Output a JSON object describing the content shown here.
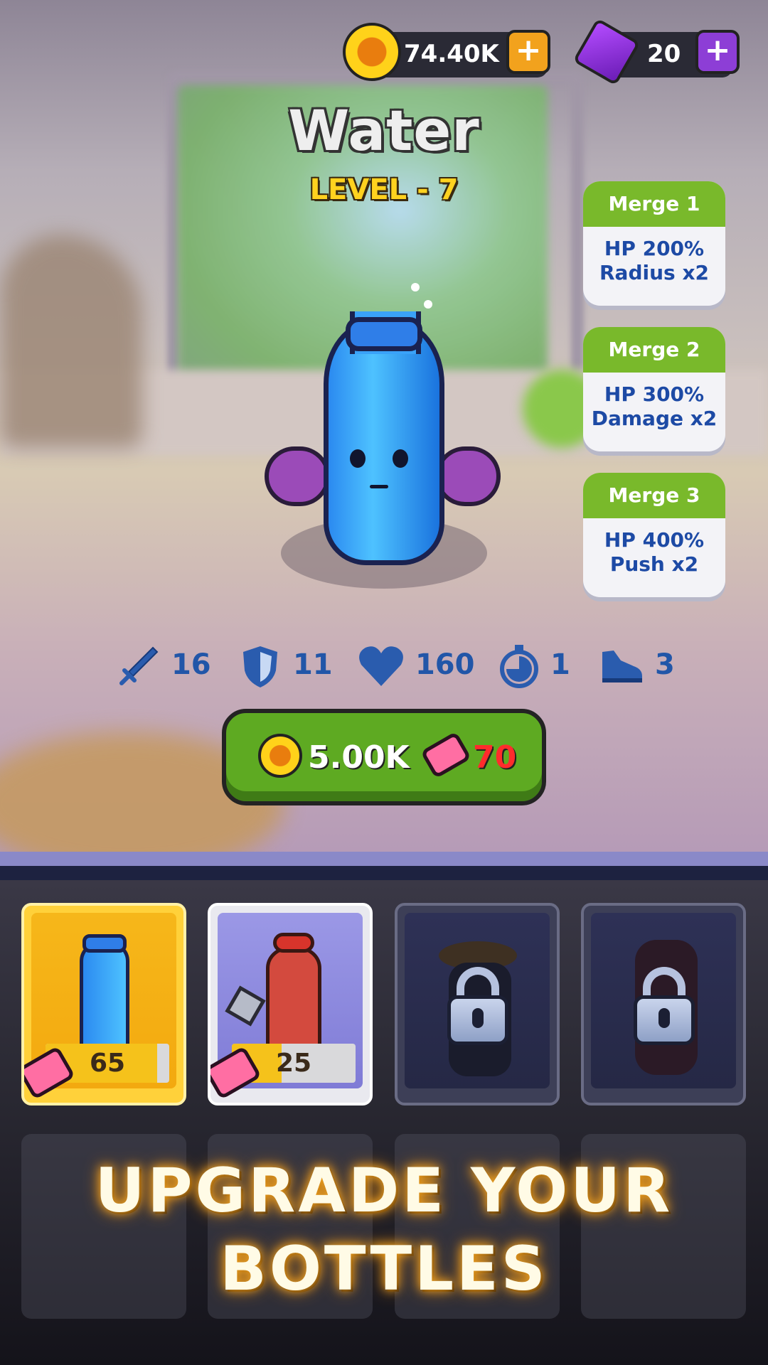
{
  "currency": {
    "coins": "74.40K",
    "gems": "20",
    "coin_plus": "+",
    "gem_plus": "+"
  },
  "bottle": {
    "name": "Water",
    "level": "LEVEL - 7"
  },
  "merges": [
    {
      "title": "Merge 1",
      "line1": "HP 200%",
      "line2": "Radius x2"
    },
    {
      "title": "Merge 2",
      "line1": "HP 300%",
      "line2": "Damage x2"
    },
    {
      "title": "Merge 3",
      "line1": "HP 400%",
      "line2": "Push x2"
    }
  ],
  "stats": {
    "attack": "16",
    "defense": "11",
    "health": "160",
    "speed_timer": "1",
    "move": "3"
  },
  "upgrade": {
    "coin_cost": "5.00K",
    "ticket_cost": "70"
  },
  "cards": [
    {
      "name": "water-bottle",
      "count": "65",
      "progress": 0.9,
      "locked": false
    },
    {
      "name": "cola-bottle",
      "count": "25",
      "progress": 0.4,
      "locked": false
    },
    {
      "name": "locked-bottle-3",
      "locked": true
    },
    {
      "name": "locked-bottle-4",
      "locked": true
    }
  ],
  "headline": {
    "line1": "UPGRADE YOUR",
    "line2": "BOTTLES"
  },
  "colors": {
    "accent_green": "#5eaa22",
    "merge_header": "#79b92b",
    "stat_blue": "#2156a8",
    "title_level_yellow": "#ffd21f",
    "ticket_pink": "#ff6ea3",
    "ticket_cost_red": "#ff2c2c"
  }
}
